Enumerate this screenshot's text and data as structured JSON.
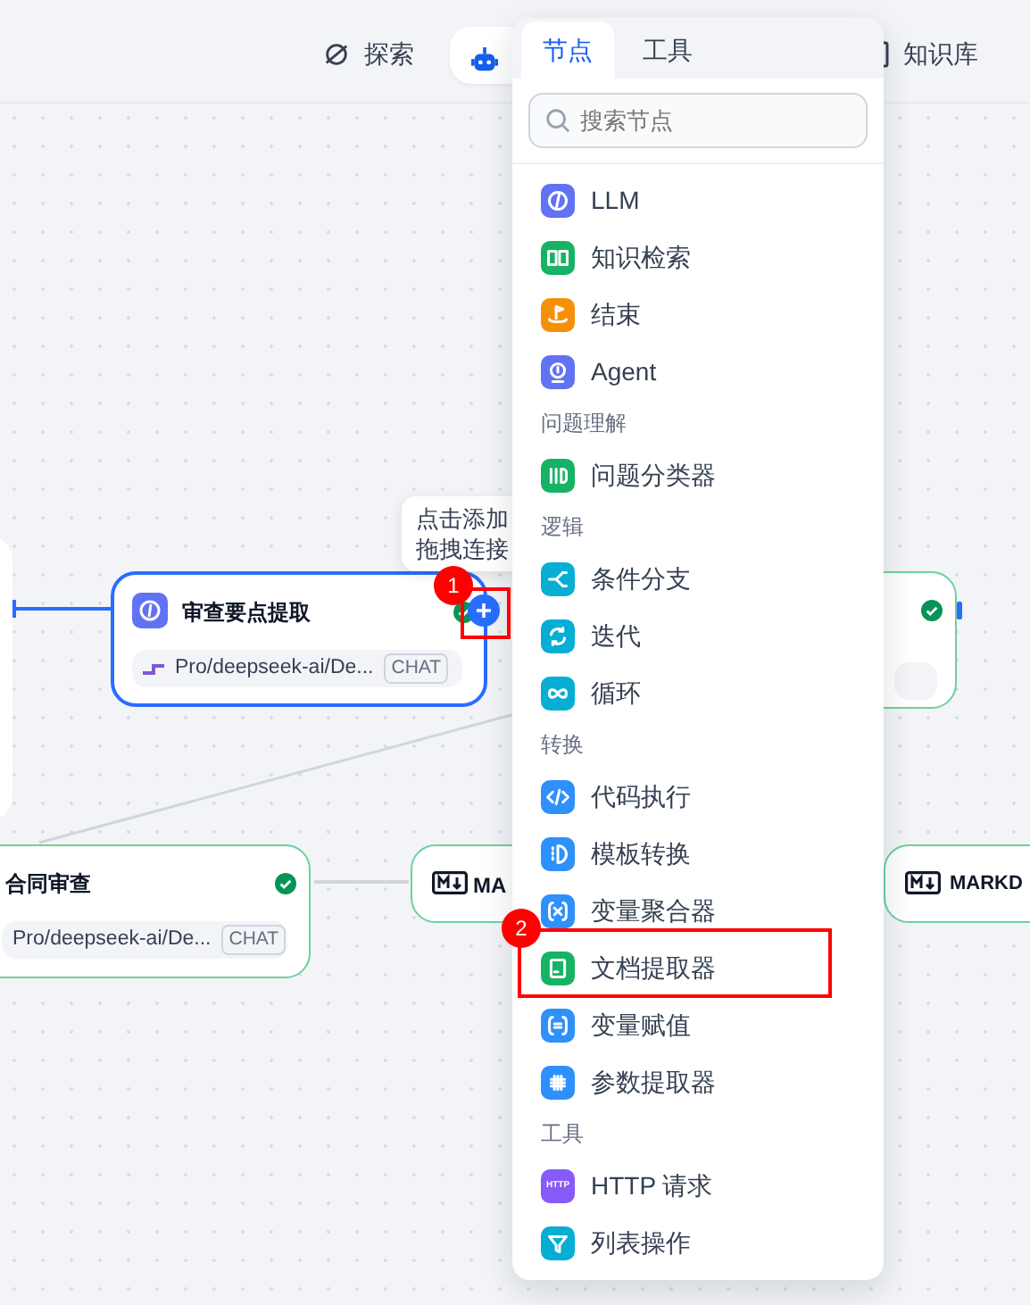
{
  "top_nav": [
    {
      "kind": "explore",
      "label": "探索",
      "selected": false
    },
    {
      "kind": "studio",
      "selected": true
    },
    {
      "kind": "knowledge",
      "label": "知识库",
      "selected": false
    }
  ],
  "canvas": {
    "nodes": [
      {
        "kind": "blank"
      },
      {
        "kind": "llm",
        "title": "审查要点提取",
        "model": "Pro/deepseek-ai/De...",
        "tag": "CHAT",
        "selected": true,
        "done": true
      },
      {
        "kind": "llm",
        "selected": false,
        "done": true
      },
      {
        "kind": "llm",
        "title": "合同审查",
        "model": "Pro/deepseek-ai/De...",
        "tag": "CHAT",
        "selected": false,
        "done": true
      },
      {
        "kind": "markdown",
        "title": "MA",
        "selected": false
      },
      {
        "kind": "markdown",
        "title": "MARKD",
        "selected": false
      }
    ],
    "tooltip": [
      "点击添加",
      "拖拽连接"
    ]
  },
  "node_menu": {
    "tabs": [
      {
        "label": "节点",
        "selected": true
      },
      {
        "label": "工具",
        "selected": false
      }
    ],
    "search": {
      "placeholder": "搜索节点"
    },
    "entries": [
      {
        "kind": "item",
        "label": "LLM",
        "color": "#6172f3"
      },
      {
        "kind": "item",
        "label": "知识检索",
        "color": "#16b364"
      },
      {
        "kind": "item",
        "label": "结束",
        "color": "#f79009"
      },
      {
        "kind": "item",
        "label": "Agent",
        "color": "#6172f3"
      },
      {
        "kind": "header",
        "label": "问题理解"
      },
      {
        "kind": "item",
        "label": "问题分类器",
        "color": "#16b364"
      },
      {
        "kind": "header",
        "label": "逻辑"
      },
      {
        "kind": "item",
        "label": "条件分支",
        "color": "#06aed4"
      },
      {
        "kind": "item",
        "label": "迭代",
        "color": "#06aed4"
      },
      {
        "kind": "item",
        "label": "循环",
        "color": "#06aed4"
      },
      {
        "kind": "header",
        "label": "转换"
      },
      {
        "kind": "item",
        "label": "代码执行",
        "color": "#2e90fa"
      },
      {
        "kind": "item",
        "label": "模板转换",
        "color": "#2e90fa"
      },
      {
        "kind": "item",
        "label": "变量聚合器",
        "color": "#2e90fa"
      },
      {
        "kind": "item",
        "label": "文档提取器",
        "color": "#16b364"
      },
      {
        "kind": "item",
        "label": "变量赋值",
        "color": "#2e90fa"
      },
      {
        "kind": "item",
        "label": "参数提取器",
        "color": "#2e90fa"
      },
      {
        "kind": "header",
        "label": "工具"
      },
      {
        "kind": "item",
        "label": "HTTP 请求",
        "color": "#875bf7",
        "icon_text": "HTTP"
      },
      {
        "kind": "item",
        "label": "列表操作",
        "color": "#06aed4"
      }
    ]
  },
  "annotations": [
    {
      "label": "1"
    },
    {
      "label": "2"
    }
  ]
}
